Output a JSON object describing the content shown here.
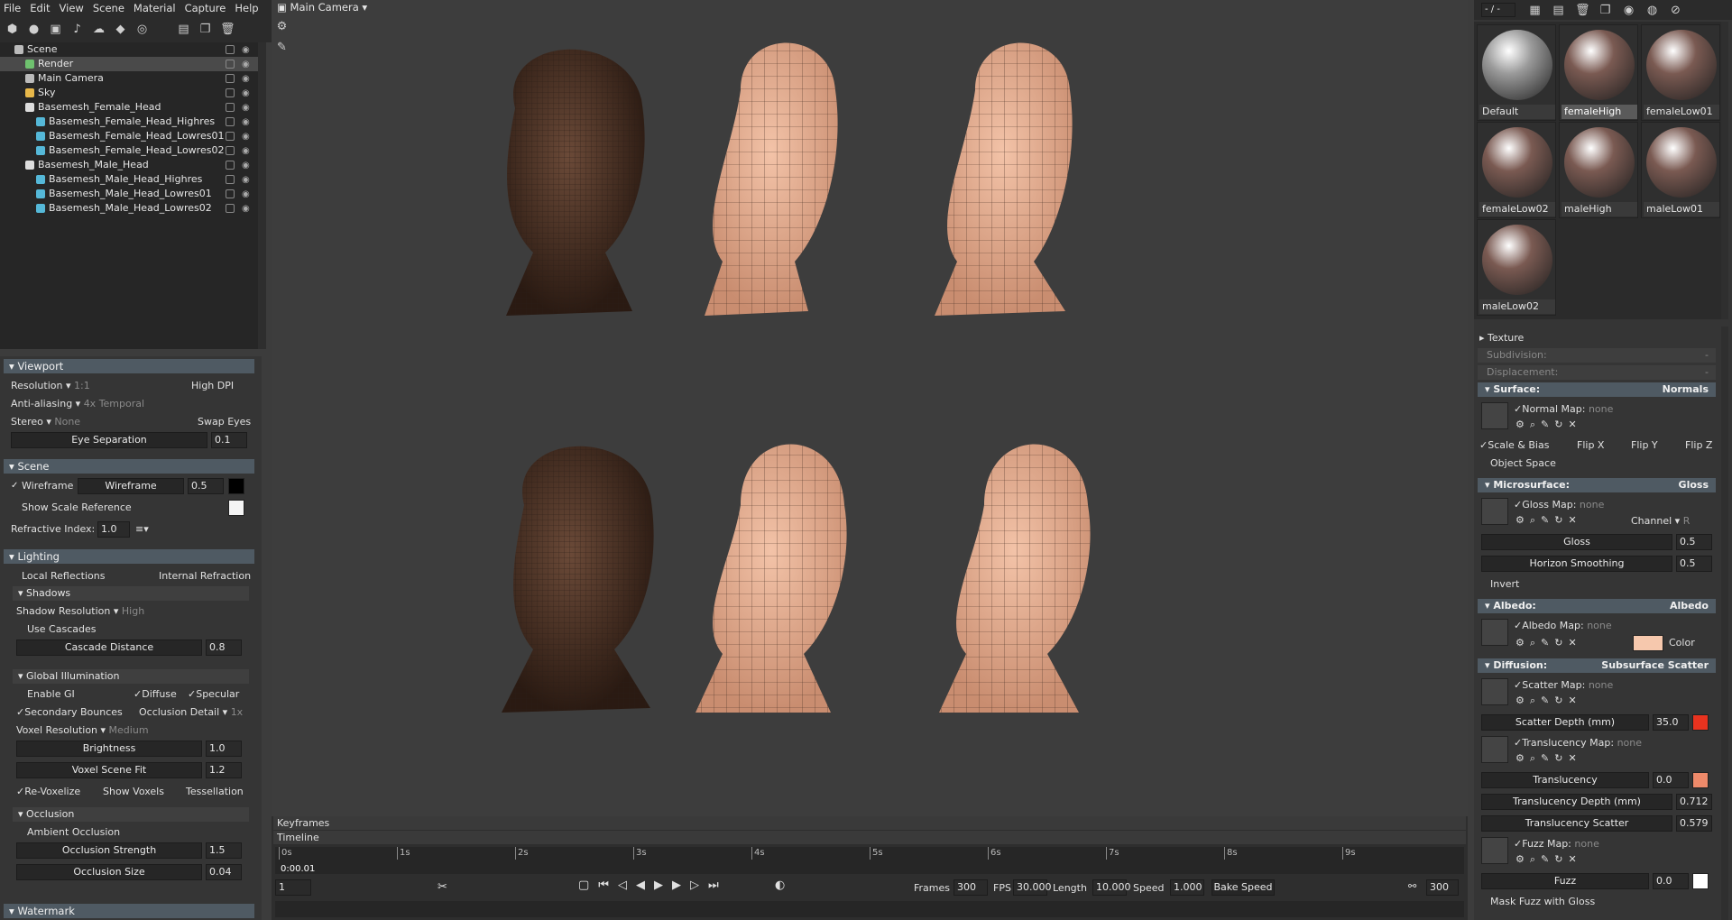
{
  "menu": [
    "File",
    "Edit",
    "View",
    "Scene",
    "Material",
    "Capture",
    "Help"
  ],
  "outliner": {
    "items": [
      {
        "label": "Scene",
        "indent": 0,
        "icon": "scene-icon",
        "color": "#bbbbbb"
      },
      {
        "label": "Render",
        "indent": 1,
        "icon": "render-icon",
        "color": "#6fc26f",
        "selected": true
      },
      {
        "label": "Main Camera",
        "indent": 1,
        "icon": "camera-icon",
        "color": "#bbbbbb"
      },
      {
        "label": "Sky",
        "indent": 1,
        "icon": "sky-icon",
        "color": "#e8b84a"
      },
      {
        "label": "Basemesh_Female_Head",
        "indent": 1,
        "icon": "object-icon",
        "color": "#dddddd"
      },
      {
        "label": "Basemesh_Female_Head_Highres",
        "indent": 2,
        "icon": "mesh-icon",
        "color": "#55b8d8"
      },
      {
        "label": "Basemesh_Female_Head_Lowres01",
        "indent": 2,
        "icon": "mesh-icon",
        "color": "#55b8d8"
      },
      {
        "label": "Basemesh_Female_Head_Lowres02",
        "indent": 2,
        "icon": "mesh-icon",
        "color": "#55b8d8"
      },
      {
        "label": "Basemesh_Male_Head",
        "indent": 1,
        "icon": "object-icon",
        "color": "#dddddd"
      },
      {
        "label": "Basemesh_Male_Head_Highres",
        "indent": 2,
        "icon": "mesh-icon",
        "color": "#55b8d8"
      },
      {
        "label": "Basemesh_Male_Head_Lowres01",
        "indent": 2,
        "icon": "mesh-icon",
        "color": "#55b8d8"
      },
      {
        "label": "Basemesh_Male_Head_Lowres02",
        "indent": 2,
        "icon": "mesh-icon",
        "color": "#55b8d8"
      }
    ]
  },
  "viewport_panel": {
    "title": "Viewport",
    "resolution_label": "Resolution",
    "resolution_value": "1:1",
    "high_dpi": "High DPI",
    "aa_label": "Anti-aliasing",
    "aa_value": "4x Temporal",
    "stereo_label": "Stereo",
    "stereo_value": "None",
    "swap_eyes": "Swap Eyes",
    "eye_sep_label": "Eye Separation",
    "eye_sep_value": "0.1"
  },
  "scene_panel": {
    "title": "Scene",
    "wireframe": "Wireframe",
    "wireframe_slider": "Wireframe",
    "wireframe_value": "0.5",
    "show_scale": "Show Scale Reference",
    "refractive_label": "Refractive Index:",
    "refractive_value": "1.0"
  },
  "lighting_panel": {
    "title": "Lighting",
    "local_reflections": "Local Reflections",
    "internal_refraction": "Internal Refraction",
    "shadows": "Shadows",
    "shadow_res_label": "Shadow Resolution",
    "shadow_res_value": "High",
    "use_cascades": "Use Cascades",
    "cascade_label": "Cascade Distance",
    "cascade_value": "0.8",
    "gi": "Global Illumination",
    "enable_gi": "Enable GI",
    "diffuse": "Diffuse",
    "specular": "Specular",
    "secondary_bounces": "Secondary Bounces",
    "occlusion_detail": "Occlusion Detail",
    "occlusion_detail_value": "1x",
    "voxel_res_label": "Voxel Resolution",
    "voxel_res_value": "Medium",
    "brightness_label": "Brightness",
    "brightness_value": "1.0",
    "voxel_fit_label": "Voxel Scene Fit",
    "voxel_fit_value": "1.2",
    "revoxelize": "Re-Voxelize",
    "show_voxels": "Show Voxels",
    "tessellation": "Tessellation",
    "occlusion": "Occlusion",
    "ambient_occlusion": "Ambient Occlusion",
    "occ_strength_label": "Occlusion Strength",
    "occ_strength_value": "1.5",
    "occ_size_label": "Occlusion Size",
    "occ_size_value": "0.04",
    "watermark": "Watermark"
  },
  "viewport": {
    "camera": "Main Camera"
  },
  "timeline": {
    "keyframes": "Keyframes",
    "timeline": "Timeline",
    "ticks": [
      "0s",
      "1s",
      "2s",
      "3s",
      "4s",
      "5s",
      "6s",
      "7s",
      "8s",
      "9s"
    ],
    "current_time": "0:00.01",
    "frame_field": "1",
    "frames_label": "Frames",
    "frames_value": "300",
    "fps_label": "FPS",
    "fps_value": "30.000",
    "length_label": "Length",
    "length_value": "10.000",
    "speed_label": "Speed",
    "speed_value": "1.000",
    "bake_speed": "Bake Speed",
    "end_value": "300"
  },
  "right_toolbar": {
    "page": "- / -"
  },
  "materials": [
    {
      "name": "Default",
      "tint": "#9a9a9a"
    },
    {
      "name": "femaleHigh",
      "tint": "#7a5a52",
      "selected": true
    },
    {
      "name": "femaleLow01",
      "tint": "#7a5a52"
    },
    {
      "name": "femaleLow02",
      "tint": "#7a5a52"
    },
    {
      "name": "maleHigh",
      "tint": "#7a5a52"
    },
    {
      "name": "maleLow01",
      "tint": "#7a5a52"
    },
    {
      "name": "maleLow02",
      "tint": "#7a5a52"
    }
  ],
  "material_props": {
    "texture": "Texture",
    "subdivision": "Subdivision:",
    "subdivision_value": "-",
    "displacement": "Displacement:",
    "displacement_value": "-",
    "surface": "Surface:",
    "surface_value": "Normals",
    "normal_map": "Normal Map:",
    "none": "none",
    "scale_bias": "Scale & Bias",
    "flip_x": "Flip X",
    "flip_y": "Flip Y",
    "flip_z": "Flip Z",
    "object_space": "Object Space",
    "microsurface": "Microsurface:",
    "microsurface_value": "Gloss",
    "gloss_map": "Gloss Map:",
    "channel": "Channel",
    "channel_value": "R",
    "gloss_label": "Gloss",
    "gloss_value": "0.5",
    "horizon_label": "Horizon Smoothing",
    "horizon_value": "0.5",
    "invert": "Invert",
    "albedo": "Albedo:",
    "albedo_value": "Albedo",
    "albedo_map": "Albedo Map:",
    "color": "Color",
    "diffusion": "Diffusion:",
    "diffusion_value": "Subsurface Scatter",
    "scatter_map": "Scatter Map:",
    "scatter_depth_label": "Scatter Depth (mm)",
    "scatter_depth_value": "35.0",
    "translucency_map": "Translucency Map:",
    "translucency_label": "Translucency",
    "translucency_value": "0.0",
    "trans_depth_label": "Translucency Depth (mm)",
    "trans_depth_value": "0.712",
    "trans_scatter_label": "Translucency Scatter",
    "trans_scatter_value": "0.579",
    "fuzz_map": "Fuzz Map:",
    "fuzz_label": "Fuzz",
    "fuzz_value": "0.0",
    "mask_fuzz": "Mask Fuzz with Gloss"
  },
  "colors": {
    "albedo_swatch": "#f6c8ad",
    "scatter_swatch": "#e8331f",
    "translucency_swatch": "#ee8a6a",
    "fuzz_swatch": "#ffffff"
  }
}
